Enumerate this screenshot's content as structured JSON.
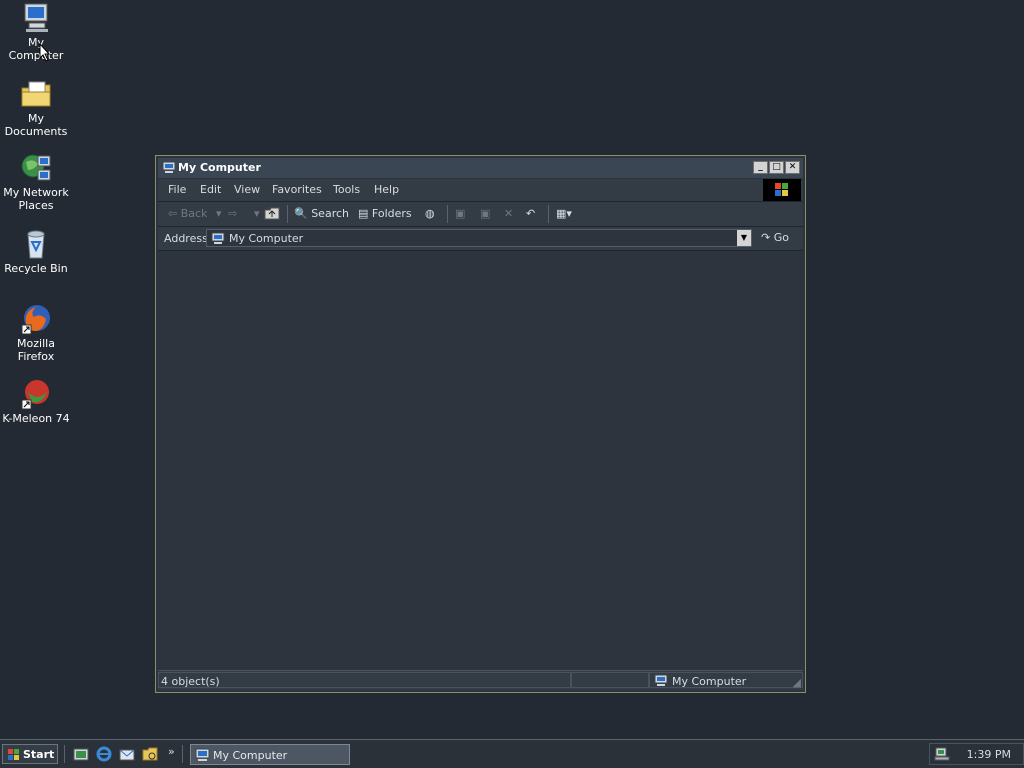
{
  "desktop": {
    "icons": [
      {
        "label": "My Computer",
        "icon": "computer-icon"
      },
      {
        "label": "My Documents",
        "icon": "folder-documents-icon"
      },
      {
        "label": "My Network",
        "label2": "Places",
        "icon": "network-icon"
      },
      {
        "label": "Recycle Bin",
        "icon": "recycle-bin-icon"
      },
      {
        "label": "Mozilla Firefox",
        "icon": "firefox-icon"
      },
      {
        "label": "K-Meleon 74",
        "icon": "kmeleon-icon"
      }
    ]
  },
  "window": {
    "title": "My Computer",
    "menu": [
      "File",
      "Edit",
      "View",
      "Favorites",
      "Tools",
      "Help"
    ],
    "toolbar": {
      "back": "Back",
      "search": "Search",
      "folders": "Folders"
    },
    "address": {
      "label": "Address",
      "value": "My Computer",
      "go": "Go"
    },
    "status": {
      "objects": "4 object(s)",
      "location": "My Computer"
    }
  },
  "taskbar": {
    "start": "Start",
    "overflow": "»",
    "task": "My Computer",
    "clock": "1:39 PM"
  },
  "colors": {
    "desktop": "#232a33",
    "window_bg": "#2d343d",
    "titlebar": "#3a4654"
  }
}
